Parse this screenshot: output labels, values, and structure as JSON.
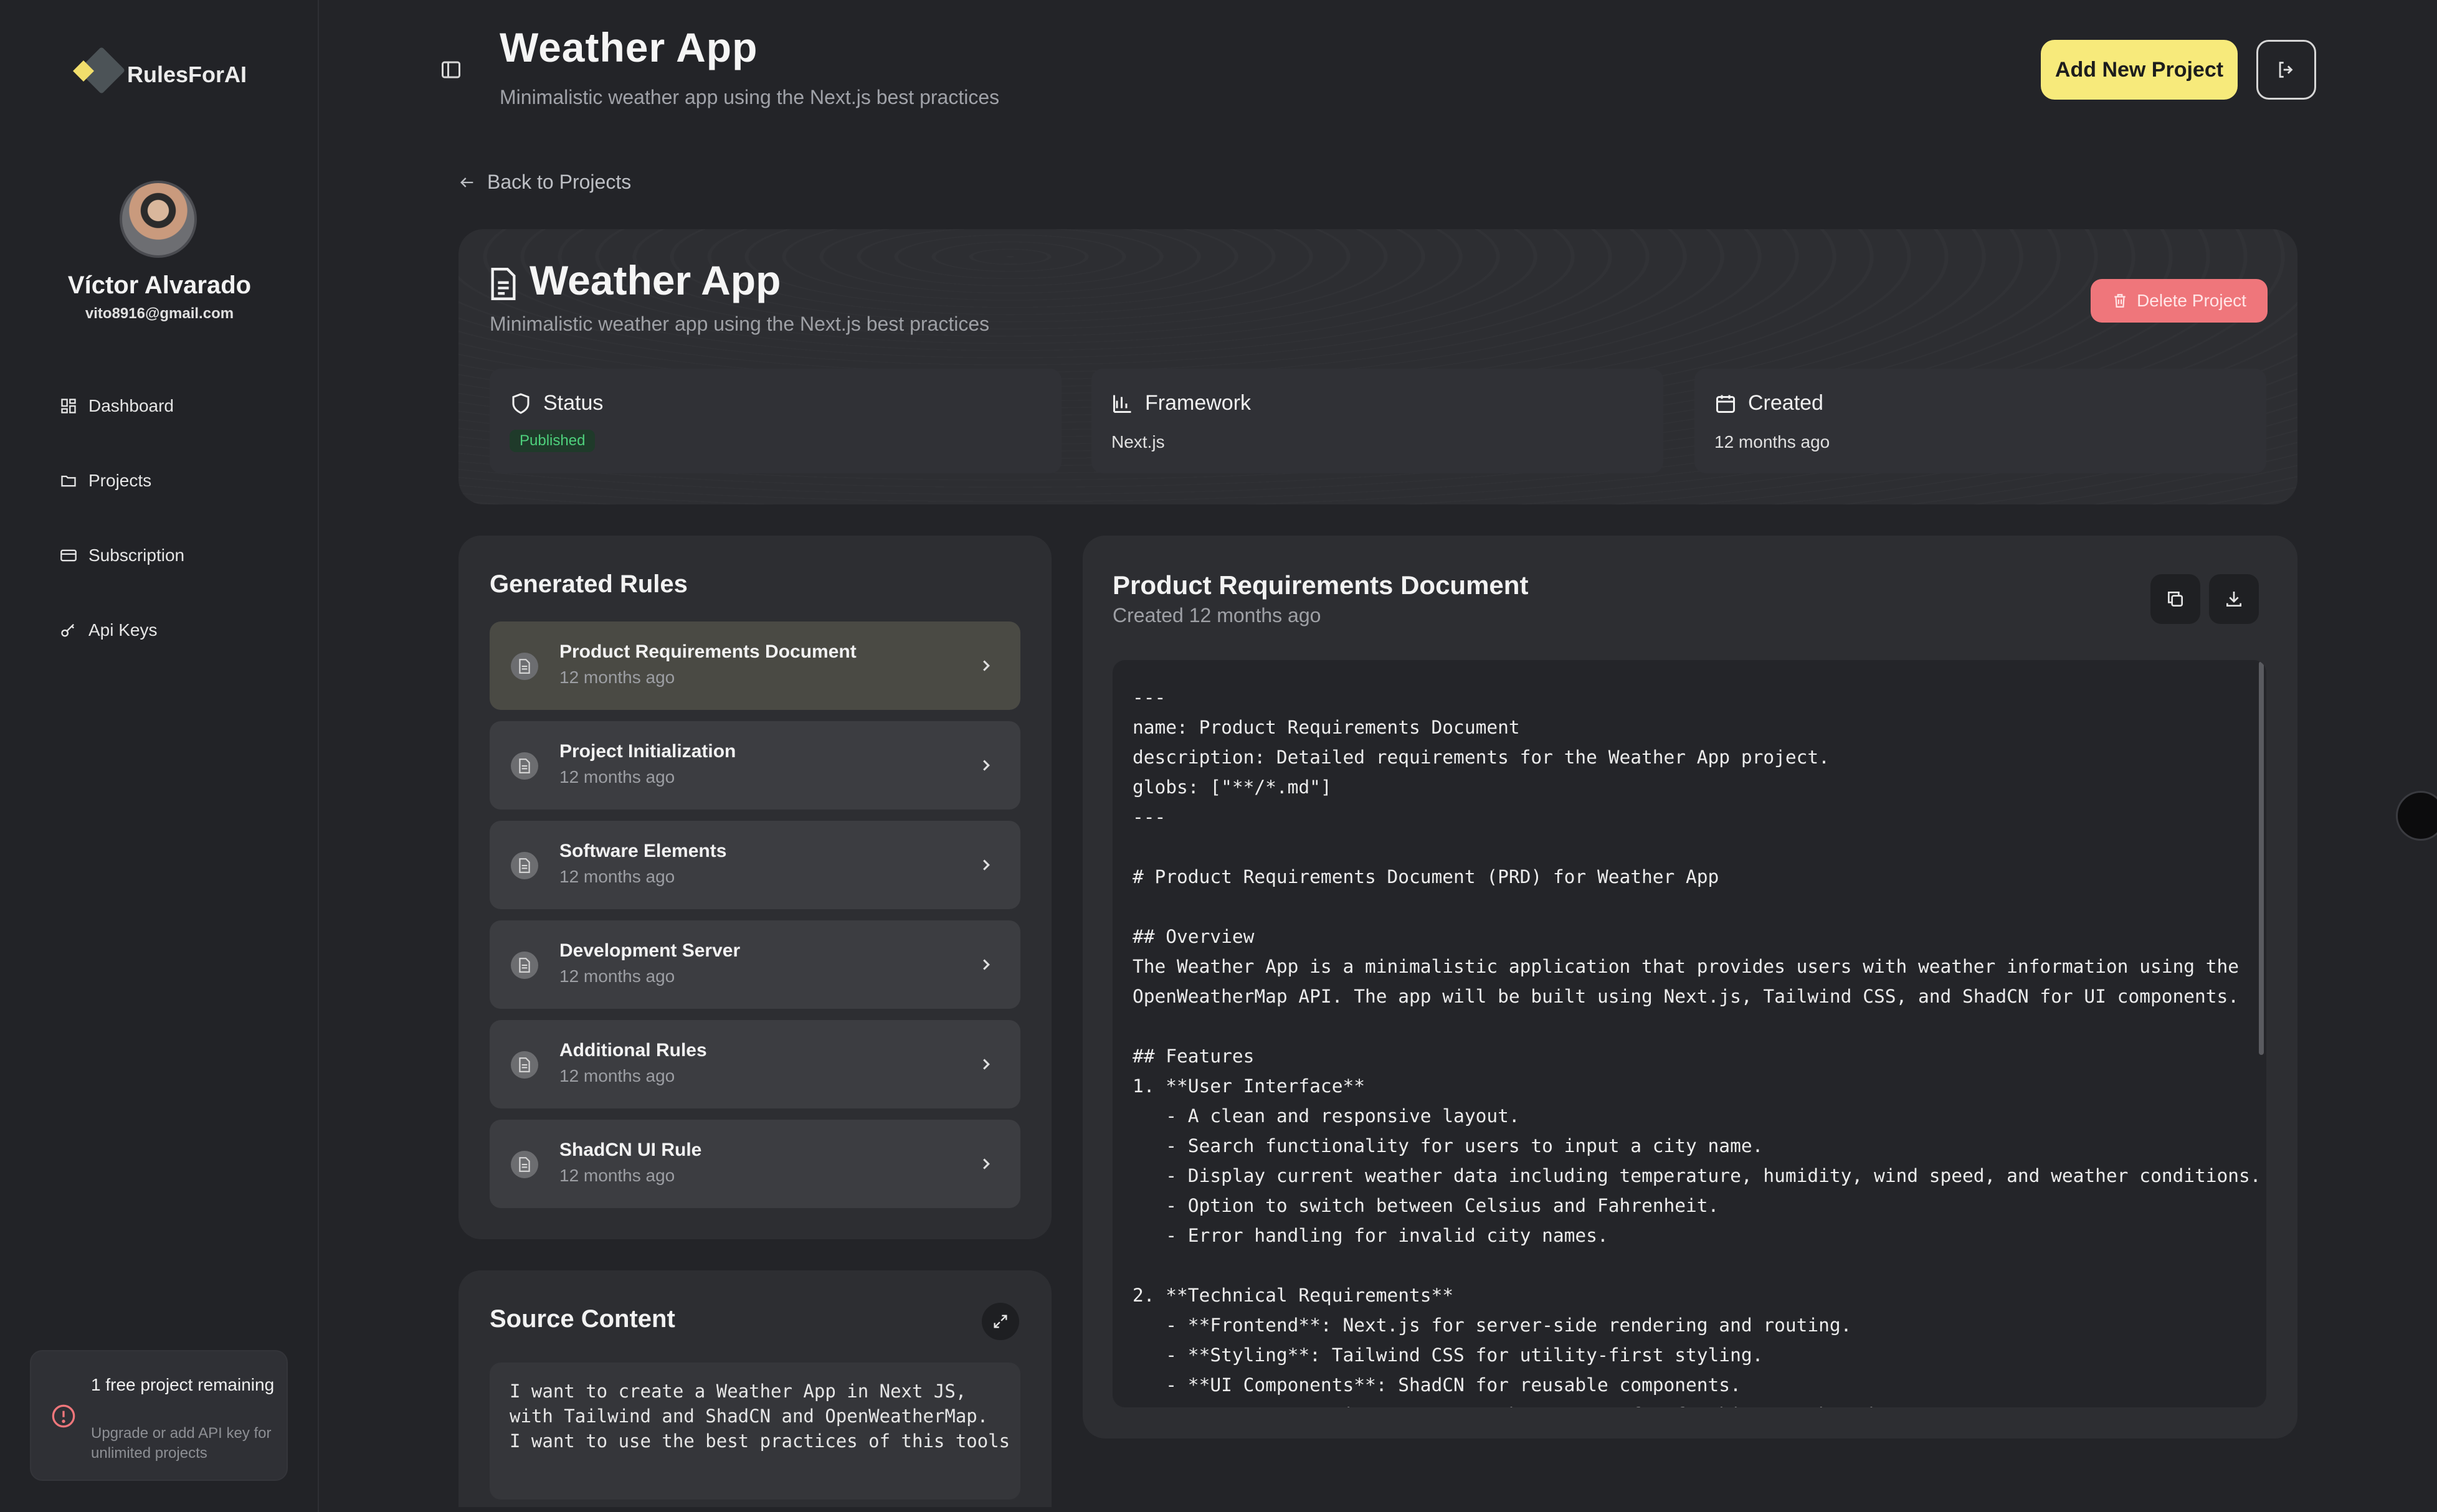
{
  "app": {
    "logo_text": "RulesForAI"
  },
  "user": {
    "name": "Víctor Alvarado",
    "email": "vito8916@gmail.com"
  },
  "nav": [
    {
      "label": "Dashboard",
      "icon": "dashboard-icon"
    },
    {
      "label": "Projects",
      "icon": "folder-icon"
    },
    {
      "label": "Subscription",
      "icon": "credit-card-icon"
    },
    {
      "label": "Api Keys",
      "icon": "key-icon"
    }
  ],
  "free_box": {
    "title": "1 free project remaining",
    "subtitle": "Upgrade or add API key for unlimited projects",
    "icon": "alert-circle-icon"
  },
  "header": {
    "title": "Weather App",
    "subtitle": "Minimalistic weather app using the Next.js best practices",
    "add_button": "Add New Project"
  },
  "back_link": "Back to Projects",
  "project": {
    "title": "Weather App",
    "subtitle": "Minimalistic weather app using the Next.js best practices",
    "delete_button": "Delete Project",
    "status_label": "Status",
    "status_value": "Published",
    "framework_label": "Framework",
    "framework_value": "Next.js",
    "created_label": "Created",
    "created_value": "12 months ago"
  },
  "generated_rules": {
    "title": "Generated Rules",
    "items": [
      {
        "name": "Product Requirements Document",
        "time": "12 months ago"
      },
      {
        "name": "Project Initialization",
        "time": "12 months ago"
      },
      {
        "name": "Software Elements",
        "time": "12 months ago"
      },
      {
        "name": "Development Server",
        "time": "12 months ago"
      },
      {
        "name": "Additional Rules",
        "time": "12 months ago"
      },
      {
        "name": "ShadCN UI Rule",
        "time": "12 months ago"
      }
    ]
  },
  "source_content": {
    "title": "Source Content",
    "text": "I want to create a Weather App in Next JS,\nwith Tailwind and ShadCN and OpenWeatherMap.\nI want to use the best practices of this tools"
  },
  "document": {
    "title": "Product Requirements Document",
    "subtitle": "Created 12 months ago",
    "content": "---\nname: Product Requirements Document\ndescription: Detailed requirements for the Weather App project.\nglobs: [\"**/*.md\"]\n---\n\n# Product Requirements Document (PRD) for Weather App\n\n## Overview\nThe Weather App is a minimalistic application that provides users with weather information using the\nOpenWeatherMap API. The app will be built using Next.js, Tailwind CSS, and ShadCN for UI components.\n\n## Features\n1. **User Interface**\n   - A clean and responsive layout.\n   - Search functionality for users to input a city name.\n   - Display current weather data including temperature, humidity, wind speed, and weather conditions.\n   - Option to switch between Celsius and Fahrenheit.\n   - Error handling for invalid city names.\n\n2. **Technical Requirements**\n   - **Frontend**: Next.js for server-side rendering and routing.\n   - **Styling**: Tailwind CSS for utility-first styling.\n   - **UI Components**: ShadCN for reusable components.\n   - **API Integration**: OpenWeatherMap API for fetching weather data."
  },
  "colors": {
    "accent": "#f7ea7b",
    "danger": "#ef767b",
    "success": "#4ed07c",
    "background": "#232428"
  }
}
